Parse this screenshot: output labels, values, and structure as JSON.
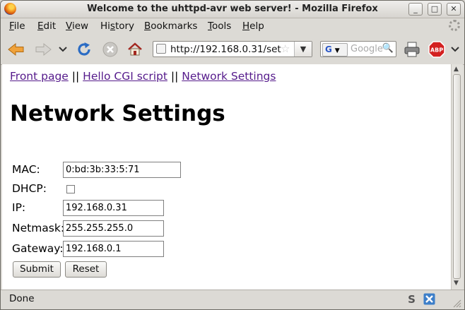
{
  "window": {
    "title": "Welcome to the uhttpd-avr web server! - Mozilla Firefox",
    "controls": {
      "minimize": "_",
      "maximize": "□",
      "close": "✕"
    }
  },
  "menubar": {
    "items": [
      {
        "label": "File",
        "key": "F",
        "rest": "ile"
      },
      {
        "label": "Edit",
        "key": "E",
        "rest": "dit"
      },
      {
        "label": "View",
        "key": "V",
        "rest": "iew"
      },
      {
        "label": "History",
        "key": "s",
        "pre": "Hi",
        "rest": "tory"
      },
      {
        "label": "Bookmarks",
        "key": "B",
        "rest": "ookmarks"
      },
      {
        "label": "Tools",
        "key": "T",
        "rest": "ools"
      },
      {
        "label": "Help",
        "key": "H",
        "rest": "elp"
      }
    ]
  },
  "navbar": {
    "url": "http://192.168.0.31/set",
    "search_placeholder": "Google",
    "search_engine": "G",
    "icons": [
      "back-icon",
      "forward-icon",
      "history-dropdown-icon",
      "reload-icon",
      "stop-icon",
      "home-icon",
      "print-icon",
      "adblock-icon",
      "overflow-chevron-icon"
    ],
    "adblock_label": "ABP"
  },
  "page": {
    "links": [
      {
        "text": "Front page"
      },
      {
        "text": "Hello CGI script"
      },
      {
        "text": "Network Settings"
      }
    ],
    "separator": "||",
    "heading": "Network Settings",
    "form": {
      "mac_label": "MAC:",
      "mac_value": "0:bd:3b:33:5:71",
      "dhcp_label": "DHCP:",
      "dhcp_checked": false,
      "ip_label": "IP:",
      "ip_value": "192.168.0.31",
      "netmask_label": "Netmask:",
      "netmask_value": "255.255.255.0",
      "gateway_label": "Gateway:",
      "gateway_value": "192.168.0.1",
      "submit_label": "Submit",
      "reset_label": "Reset"
    }
  },
  "statusbar": {
    "status": "Done"
  },
  "colors": {
    "visited_link": "#551a8b",
    "adblock_red": "#d32020"
  }
}
